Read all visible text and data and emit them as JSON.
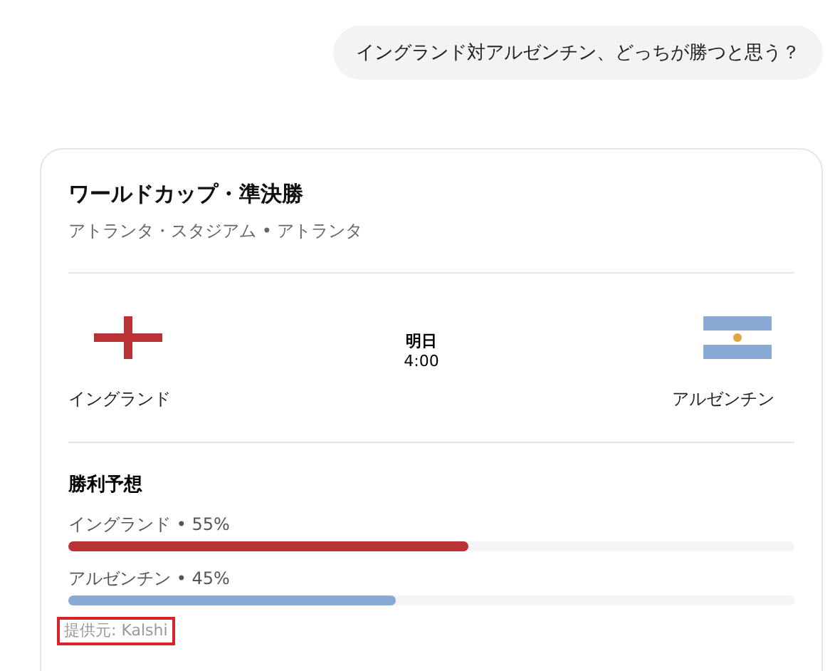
{
  "user_message": "イングランド対アルゼンチン、どっちが勝つと思う？",
  "match": {
    "title": "ワールドカップ・準決勝",
    "venue": "アトランタ・スタジアム • アトランタ",
    "teams": [
      {
        "name": "イングランド",
        "kind": "england"
      },
      {
        "name": "アルゼンチン",
        "kind": "argentina"
      }
    ],
    "day": "明日",
    "time": "4:00"
  },
  "prediction": {
    "title": "勝利予想",
    "rows": [
      {
        "label": "イングランド • 55%",
        "level": 0.55,
        "color": "#b83236"
      },
      {
        "label": "アルゼンチン • 45%",
        "level": 0.45,
        "color": "#8aaad6"
      }
    ],
    "source": {
      "text": "提供元: Kalshi",
      "highlighted": true
    }
  }
}
